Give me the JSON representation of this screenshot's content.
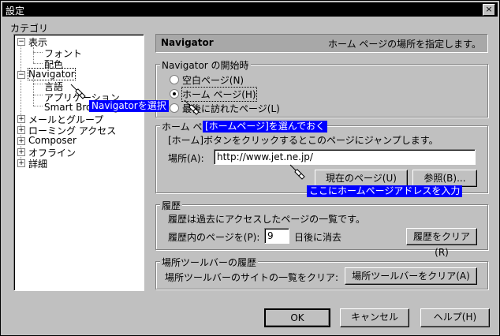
{
  "window": {
    "title": "設定",
    "close_glyph": "×"
  },
  "category_label": "カテゴリ",
  "tree": {
    "display": "表示",
    "font": "フォント",
    "color": "配色",
    "navigator": "Navigator",
    "language": "言語",
    "application": "アプリケーション",
    "smart_browsing": "Smart Browsing",
    "mail_groups": "メールとグループ",
    "roaming": "ローミング アクセス",
    "composer": "Composer",
    "offline": "オフライン",
    "advanced": "詳細"
  },
  "header": {
    "title": "Navigator",
    "description": "ホーム ページの場所を指定します。"
  },
  "startup": {
    "legend": "Navigator の開始時",
    "opt_blank": "空白ページ(N)",
    "opt_home": "ホーム ページ(H)",
    "opt_last": "最後に訪れたページ(L)"
  },
  "home": {
    "legend": "ホーム ページ",
    "desc": "[ホーム]ボタンをクリックするとこのページにジャンプします。",
    "location_label": "場所(A):",
    "url": "http://www.jet.ne.jp/",
    "current_page_btn": "現在のページ(U)",
    "browse_btn": "参照(B)..."
  },
  "history": {
    "legend": "履歴",
    "desc": "履歴は過去にアクセスしたページの一覧です。",
    "expire_label": "履歴内のページを(P):",
    "days": "9",
    "days_suffix": "日後に消去",
    "clear_btn": "履歴をクリア(R)"
  },
  "locbar": {
    "legend": "場所ツールバーの履歴",
    "desc": "場所ツールバーのサイトの一覧をクリア:",
    "clear_btn": "場所ツールバーをクリア(A)"
  },
  "buttons": {
    "ok": "OK",
    "cancel": "キャンセル",
    "help": "ヘルプ(H)"
  },
  "callouts": {
    "select_nav": "Navigatorを選択",
    "choose_home": "[ホームページ]を選んでおく",
    "enter_url": "ここにホームページアドレスを入力"
  },
  "colors": {
    "callout_bg": "#0000ff",
    "window_bg": "#c0c0c0",
    "title_bg": "#000000"
  }
}
